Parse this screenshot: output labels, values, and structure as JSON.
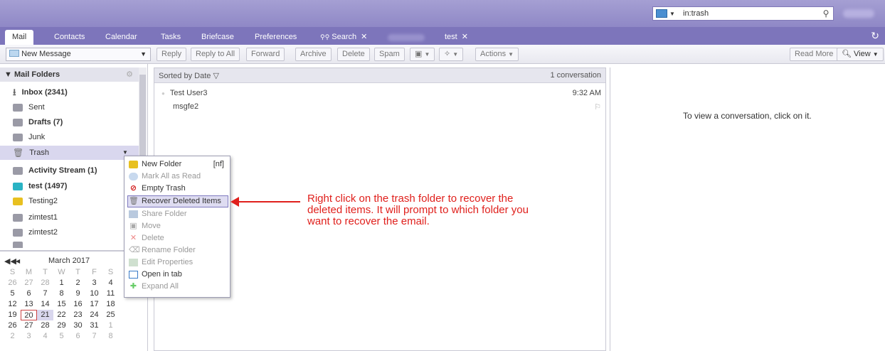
{
  "search": {
    "value": "in:trash"
  },
  "tabs": [
    {
      "label": "Mail"
    },
    {
      "label": "Contacts"
    },
    {
      "label": "Calendar"
    },
    {
      "label": "Tasks"
    },
    {
      "label": "Briefcase"
    },
    {
      "label": "Preferences"
    },
    {
      "label": "Search"
    },
    {
      "label": "test"
    }
  ],
  "toolbar": {
    "new_message": "New Message",
    "reply": "Reply",
    "reply_all": "Reply to All",
    "forward": "Forward",
    "archive": "Archive",
    "delete": "Delete",
    "spam": "Spam",
    "actions": "Actions",
    "read_more": "Read More",
    "view": "View"
  },
  "sidebar": {
    "header": "Mail Folders",
    "folders": [
      {
        "label": "Inbox (2341)",
        "icon": "inbox-icon",
        "color": "#6b6b6b"
      },
      {
        "label": "Sent",
        "icon": "sent-icon",
        "color": "#8d8d96"
      },
      {
        "label": "Drafts (7)",
        "icon": "drafts-icon",
        "color": "#8d8d96"
      },
      {
        "label": "Junk",
        "icon": "junk-icon",
        "color": "#8d8d96"
      },
      {
        "label": "Trash",
        "icon": "trash-icon",
        "color": "#8d8d96"
      },
      {
        "label": "Activity Stream (1)",
        "icon": "folder-icon",
        "color": "#8d8d96"
      },
      {
        "label": "test (1497)",
        "icon": "folder-icon",
        "color": "#2ab3c4"
      },
      {
        "label": "Testing2",
        "icon": "folder-icon",
        "color": "#e8c020"
      },
      {
        "label": "zimtest1",
        "icon": "folder-icon",
        "color": "#8d8d96"
      },
      {
        "label": "zimtest2",
        "icon": "folder-icon",
        "color": "#8d8d96"
      }
    ]
  },
  "calendar": {
    "month": "March 2017",
    "weekdays": [
      "S",
      "M",
      "T",
      "W",
      "T",
      "F",
      "S"
    ],
    "days": [
      [
        "26",
        "27",
        "28",
        "1",
        "2",
        "3",
        "4"
      ],
      [
        "5",
        "6",
        "7",
        "8",
        "9",
        "10",
        "11"
      ],
      [
        "12",
        "13",
        "14",
        "15",
        "16",
        "17",
        "18"
      ],
      [
        "19",
        "20",
        "21",
        "22",
        "23",
        "24",
        "25"
      ],
      [
        "26",
        "27",
        "28",
        "29",
        "30",
        "31",
        "1"
      ],
      [
        "2",
        "3",
        "4",
        "5",
        "6",
        "7",
        "8"
      ]
    ]
  },
  "list": {
    "sort_label": "Sorted by Date",
    "count": "1 conversation",
    "messages": [
      {
        "from": "Test User3",
        "time": "9:32 AM",
        "subject": "msgfe2"
      }
    ]
  },
  "reading_pane": {
    "hint": "To view a conversation, click on it."
  },
  "context_menu": {
    "items": [
      {
        "label": "New Folder",
        "shortcut": "[nf]",
        "icon": "new-folder-icon",
        "enabled": true
      },
      {
        "label": "Mark All as Read",
        "icon": "mark-read-icon",
        "enabled": false
      },
      {
        "label": "Empty Trash",
        "icon": "empty-trash-icon",
        "enabled": true
      },
      {
        "label": "Recover Deleted Items",
        "icon": "recover-icon",
        "enabled": true
      },
      {
        "label": "Share Folder",
        "icon": "share-icon",
        "enabled": false
      },
      {
        "label": "Move",
        "icon": "move-icon",
        "enabled": false
      },
      {
        "label": "Delete",
        "icon": "delete-icon",
        "enabled": false
      },
      {
        "label": "Rename Folder",
        "icon": "rename-icon",
        "enabled": false
      },
      {
        "label": "Edit Properties",
        "icon": "properties-icon",
        "enabled": false
      },
      {
        "label": "Open in tab",
        "icon": "open-tab-icon",
        "enabled": true
      },
      {
        "label": "Expand All",
        "icon": "expand-icon",
        "enabled": false
      }
    ]
  },
  "annotation": {
    "text": "Right click on the trash folder to recover the deleted items. It will prompt to which folder you want to recover the email.",
    "line1": "Right click on the trash folder to recover the",
    "line2": "deleted items. It will prompt to which folder you",
    "line3": "want to recover the email.",
    "color": "#e0201c"
  }
}
